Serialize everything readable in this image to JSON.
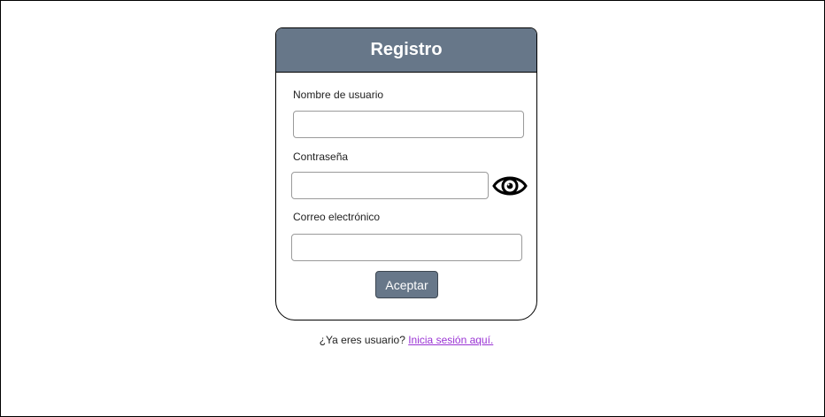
{
  "form": {
    "title": "Registro",
    "username_label": "Nombre de usuario",
    "username_value": "",
    "password_label": "Contraseña",
    "password_value": "",
    "password_toggle_icon": "eye-icon",
    "email_label": "Correo electrónico",
    "email_value": "",
    "submit_label": "Aceptar"
  },
  "footer": {
    "prompt": "¿Ya eres usuario?",
    "login_link": "Inicia sesión aquí."
  },
  "colors": {
    "header_bg": "#677789",
    "button_bg": "#677789",
    "link": "#9a33d4"
  }
}
